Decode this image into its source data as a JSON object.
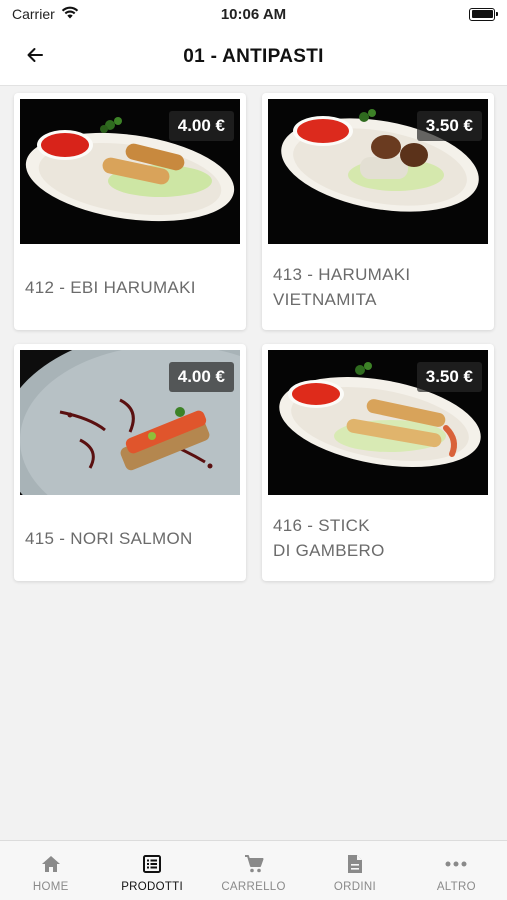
{
  "status_bar": {
    "carrier": "Carrier",
    "time": "10:06 AM"
  },
  "header": {
    "title": "01 - ANTIPASTI"
  },
  "products": [
    {
      "name": "412 - EBI HARUMAKI",
      "price": "4.00 €",
      "image": "spring-rolls-dish"
    },
    {
      "name": "413 - HARUMAKI\nVIETNAMITA",
      "price": "3.50 €",
      "image": "vietnamese-rolls-dish"
    },
    {
      "name": "415 - NORI SALMON",
      "price": "4.00 €",
      "image": "nori-salmon-dish"
    },
    {
      "name": "416 - STICK\nDI GAMBERO",
      "price": "3.50 €",
      "image": "shrimp-stick-dish"
    }
  ],
  "bottom_nav": {
    "items": [
      {
        "label": "HOME",
        "icon": "home-icon",
        "active": false
      },
      {
        "label": "PRODOTTI",
        "icon": "list-icon",
        "active": true
      },
      {
        "label": "CARRELLO",
        "icon": "cart-icon",
        "active": false
      },
      {
        "label": "ORDINI",
        "icon": "document-icon",
        "active": false
      },
      {
        "label": "ALTRO",
        "icon": "more-icon",
        "active": false
      }
    ]
  },
  "colors": {
    "active_nav": "#111111",
    "inactive_nav": "#8a8a8a",
    "title_text": "#6b6b6b",
    "background": "#f2f2f2"
  }
}
